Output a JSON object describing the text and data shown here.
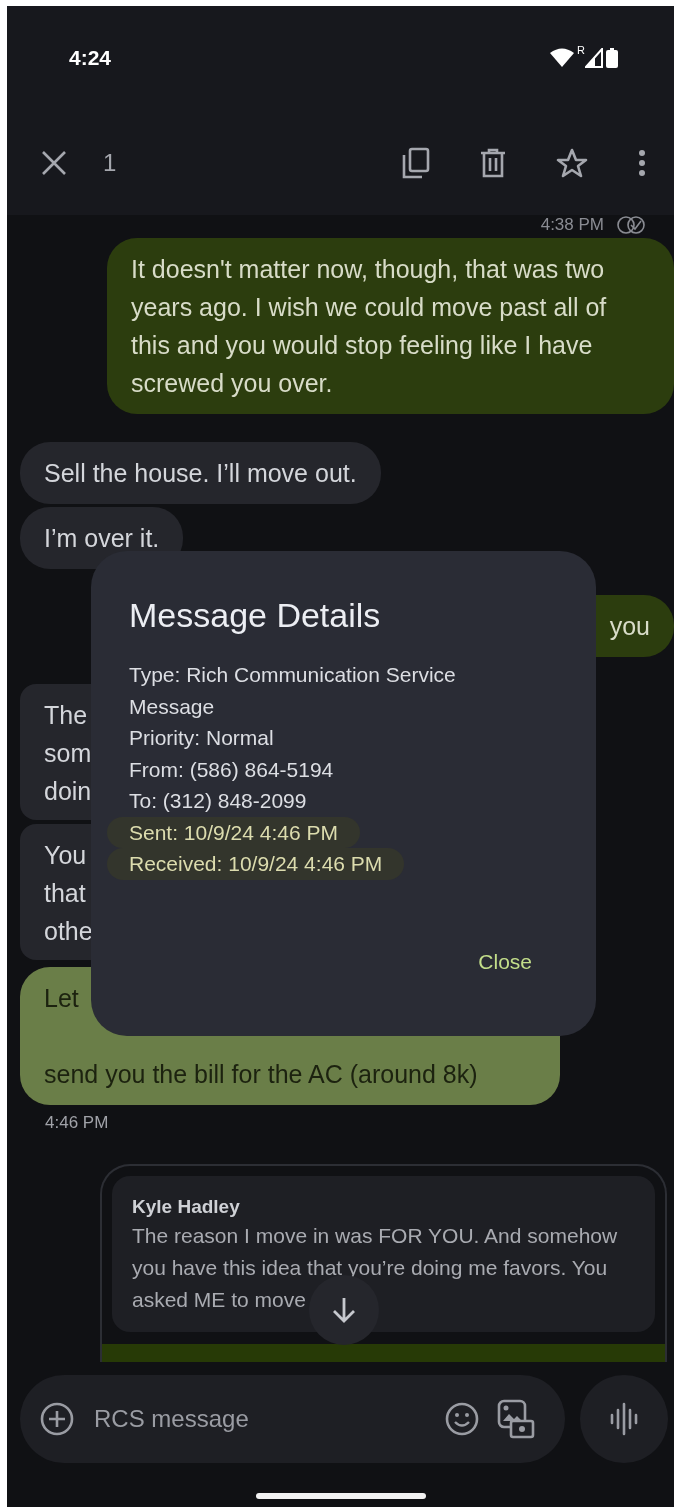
{
  "status_bar": {
    "time": "4:24",
    "roaming": "R"
  },
  "selection_toolbar": {
    "count": "1"
  },
  "messages": [
    {
      "kind": "meta",
      "time": "4:38 PM"
    },
    {
      "kind": "outgoing",
      "selected": false,
      "text": "It doesn't matter now, though, that was two years ago. I wish we could move past all of this and you would stop feeling like I have screwed you over."
    },
    {
      "kind": "incoming",
      "selected": false,
      "text": "Sell the house. I’ll move out."
    },
    {
      "kind": "incoming",
      "selected": false,
      "text": "I’m over it."
    },
    {
      "kind": "outgoing",
      "selected": false,
      "lines": [
        "you"
      ]
    },
    {
      "kind": "incoming",
      "selected": false,
      "lines": [
        "The",
        "som",
        "doin"
      ]
    },
    {
      "kind": "incoming",
      "selected": false,
      "lines": [
        "You",
        "that",
        "othe"
      ]
    },
    {
      "kind": "incoming",
      "selected": true,
      "lines": [
        "Let",
        "send you the bill for the AC (around 8k)"
      ]
    },
    {
      "kind": "time",
      "time": "4:46 PM"
    },
    {
      "kind": "reply",
      "sender": "Kyle Hadley",
      "quote_lines": [
        "The reason I move in was FOR YOU. And somehow",
        "you have this idea that you’re doing me favors. You",
        "asked ME to move"
      ]
    }
  ],
  "compose": {
    "placeholder": "RCS message"
  },
  "dialog": {
    "title": "Message Details",
    "lines": [
      {
        "text": "Type: Rich Communication Service Message",
        "highlighted": false
      },
      {
        "text": "Priority: Normal",
        "highlighted": false
      },
      {
        "text": "From: (586) 864-5194",
        "highlighted": false
      },
      {
        "text": "To: (312) 848-2099",
        "highlighted": false
      },
      {
        "text": "Sent: 10/9/24 4:46 PM",
        "highlighted": true
      },
      {
        "text": "Received: 10/9/24 4:46 PM",
        "highlighted": true
      }
    ],
    "button": "Close"
  }
}
